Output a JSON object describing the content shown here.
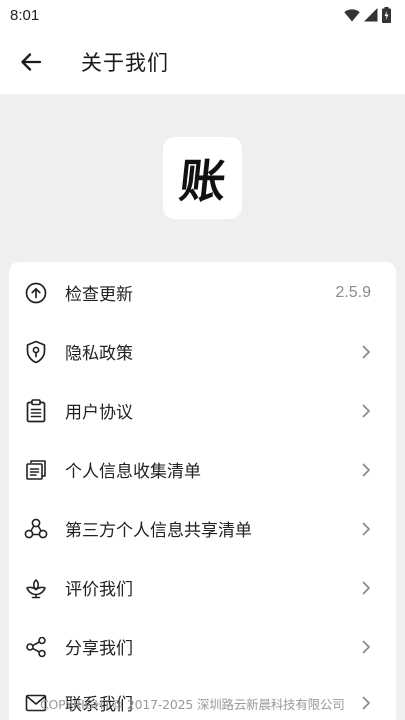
{
  "status_bar": {
    "time": "8:01"
  },
  "header": {
    "title": "关于我们"
  },
  "logo": {
    "char": "账"
  },
  "menu": [
    {
      "label": "检查更新",
      "value": "2.5.9",
      "icon": "upload-circle-icon"
    },
    {
      "label": "隐私政策",
      "icon": "shield-lock-icon"
    },
    {
      "label": "用户协议",
      "icon": "clipboard-icon"
    },
    {
      "label": "个人信息收集清单",
      "icon": "document-copy-icon"
    },
    {
      "label": "第三方个人信息共享清单",
      "icon": "share-nodes-triangle-icon"
    },
    {
      "label": "评价我们",
      "icon": "flower-icon"
    },
    {
      "label": "分享我们",
      "icon": "share-icon"
    },
    {
      "label": "联系我们",
      "icon": "mail-icon"
    }
  ],
  "footer": {
    "copyright": "COPYRIGHT© 2017-2025 深圳路云新晨科技有限公司"
  }
}
